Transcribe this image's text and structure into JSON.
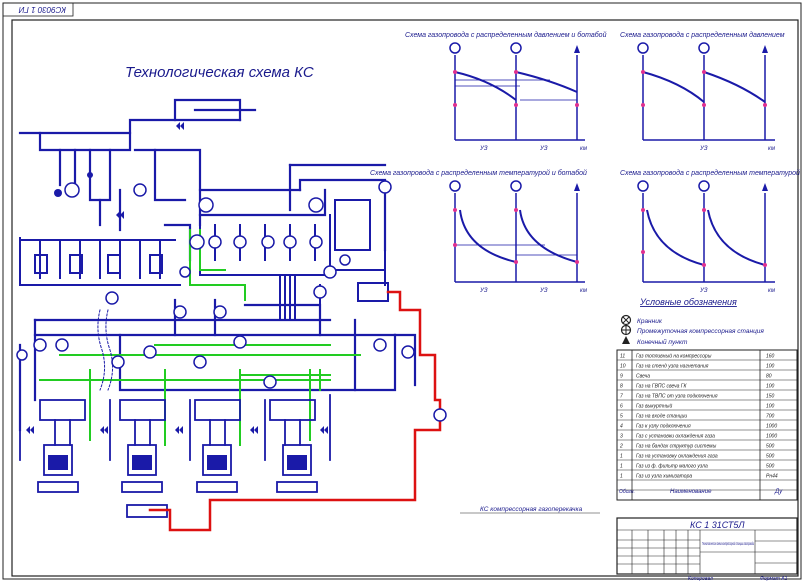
{
  "sheet": {
    "stamp_top": "КС9030 1 ГИ",
    "title": "Технологическая схема КС"
  },
  "charts": {
    "c1": {
      "title": "Схема газопровода с распределенным давлением и ботабой",
      "axis_labels": [
        "УЗ",
        "УЗ",
        "км"
      ]
    },
    "c2": {
      "title": "Схема газопровода с распределенным давлением",
      "axis_labels": [
        "УЗ",
        "км"
      ]
    },
    "c3": {
      "title": "Схема газопровода с распределенным температурой и ботабой",
      "axis_labels": [
        "УЗ",
        "УЗ",
        "км"
      ]
    },
    "c4": {
      "title": "Схема газопровода с распределенным температурой",
      "axis_labels": [
        "УЗ",
        "км"
      ]
    }
  },
  "legend": {
    "title": "Условные обозначения",
    "items": [
      {
        "icon": "valve-circle-icon",
        "label": "Кранник"
      },
      {
        "icon": "compressor-station-icon",
        "label": "Промежуточная компрессорная станция"
      },
      {
        "icon": "triangle-icon",
        "label": "Конечный пункт"
      }
    ]
  },
  "table": {
    "rows": [
      {
        "n": "11",
        "name": "Газ топливный на компрессоры",
        "val": "160"
      },
      {
        "n": "10",
        "name": "Газ на стенд узла нагнетания",
        "val": "100"
      },
      {
        "n": "9",
        "name": "Свеча",
        "val": "80"
      },
      {
        "n": "8",
        "name": "Газ на ГВПС свеча ГК",
        "val": "100"
      },
      {
        "n": "7",
        "name": "Газ на ТВПС от узла подключения",
        "val": "150"
      },
      {
        "n": "6",
        "name": "Газ выкуртный",
        "val": "100"
      },
      {
        "n": "5",
        "name": "Газ на входе станции",
        "val": "700"
      },
      {
        "n": "4",
        "name": "Газ к узлу подключения",
        "val": "1000"
      },
      {
        "n": "3",
        "name": "Газ с установки охлаждения газа",
        "val": "1000"
      },
      {
        "n": "2",
        "name": "Газ на бандах структур системы",
        "val": "500"
      },
      {
        "n": "1",
        "name": "Газ на установку охлаждения газа",
        "val": "500"
      },
      {
        "n": "1",
        "name": "Газ из ф. фильтр малого узла",
        "val": "500"
      },
      {
        "n": "1",
        "name": "Газ из узла химизатора",
        "val": "Рн44"
      }
    ],
    "header": {
      "n": "Обозн.",
      "name": "Наименование",
      "val": "Ду"
    },
    "footer_note": "КС компрессорная газоперекачка"
  },
  "stamp": {
    "code": "КС 1 31СТ5Л",
    "desc": "Технологическая схема компрессорной станции газопровода",
    "bottom_left": "Копировал",
    "bottom_right": "Формат А1"
  },
  "colors": {
    "pipe": "#1a1aa8",
    "green_line": "#22cc22",
    "red_line": "#dd1111"
  }
}
